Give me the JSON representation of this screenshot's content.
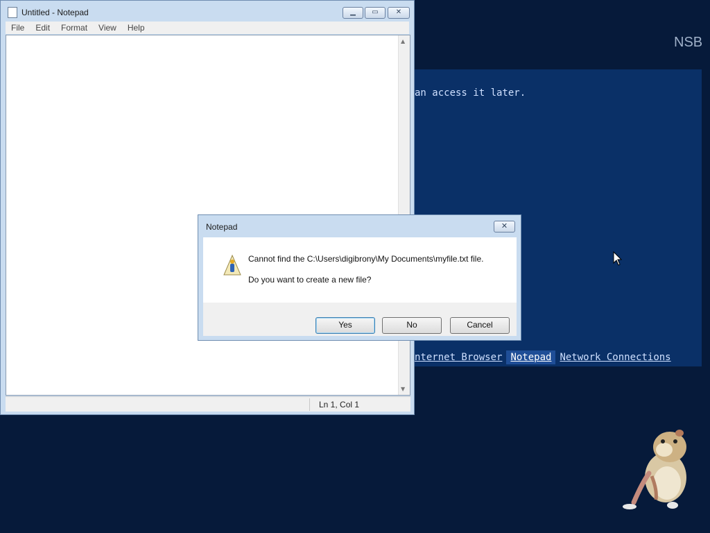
{
  "desktop": {
    "corner_label": "NSB",
    "panel_text": "an access it later.",
    "links": [
      "nternet Browser",
      "Notepad",
      "Network Connections"
    ],
    "active_link_index": 1,
    "background_color": "#061a3a",
    "panel_color": "#0a3067"
  },
  "notepad": {
    "title": "Untitled - Notepad",
    "menu": [
      "File",
      "Edit",
      "Format",
      "View",
      "Help"
    ],
    "controls": {
      "minimize_icon": "minimize-icon",
      "maximize_icon": "maximize-icon",
      "close_icon": "close-icon"
    },
    "status": {
      "position": "Ln 1, Col 1"
    }
  },
  "dialog": {
    "title": "Notepad",
    "message_line1": "Cannot find the C:\\Users\\digibrony\\My Documents\\myfile.txt file.",
    "message_line2": "Do you want to create a new file?",
    "buttons": {
      "yes": "Yes",
      "no": "No",
      "cancel": "Cancel"
    },
    "icon": "warning-shield-icon"
  }
}
